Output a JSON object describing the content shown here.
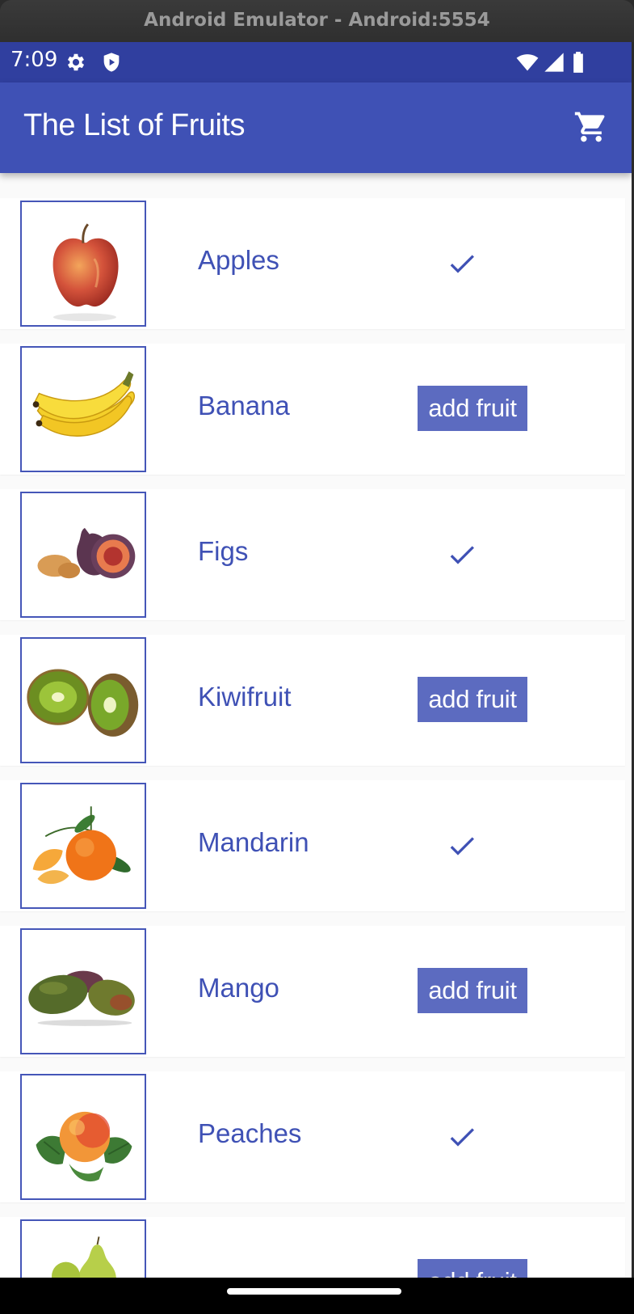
{
  "emulator": {
    "title": "Android Emulator - Android:5554"
  },
  "status_bar": {
    "time": "7:09"
  },
  "app_bar": {
    "title": "The List of Fruits",
    "accent": "#3f51b5"
  },
  "fruits": [
    {
      "name": "Apples",
      "state": "added"
    },
    {
      "name": "Banana",
      "state": "add",
      "button_label": "add fruit"
    },
    {
      "name": "Figs",
      "state": "added"
    },
    {
      "name": "Kiwifruit",
      "state": "add",
      "button_label": "add fruit"
    },
    {
      "name": "Mandarin",
      "state": "added"
    },
    {
      "name": "Mango",
      "state": "add",
      "button_label": "add fruit"
    },
    {
      "name": "Peaches",
      "state": "added"
    },
    {
      "name": "",
      "state": "add",
      "button_label": "add fruit"
    }
  ],
  "icons": [
    "gear-icon",
    "shield-icon",
    "wifi-icon",
    "signal-icon",
    "battery-icon",
    "cart-icon",
    "check-icon"
  ]
}
